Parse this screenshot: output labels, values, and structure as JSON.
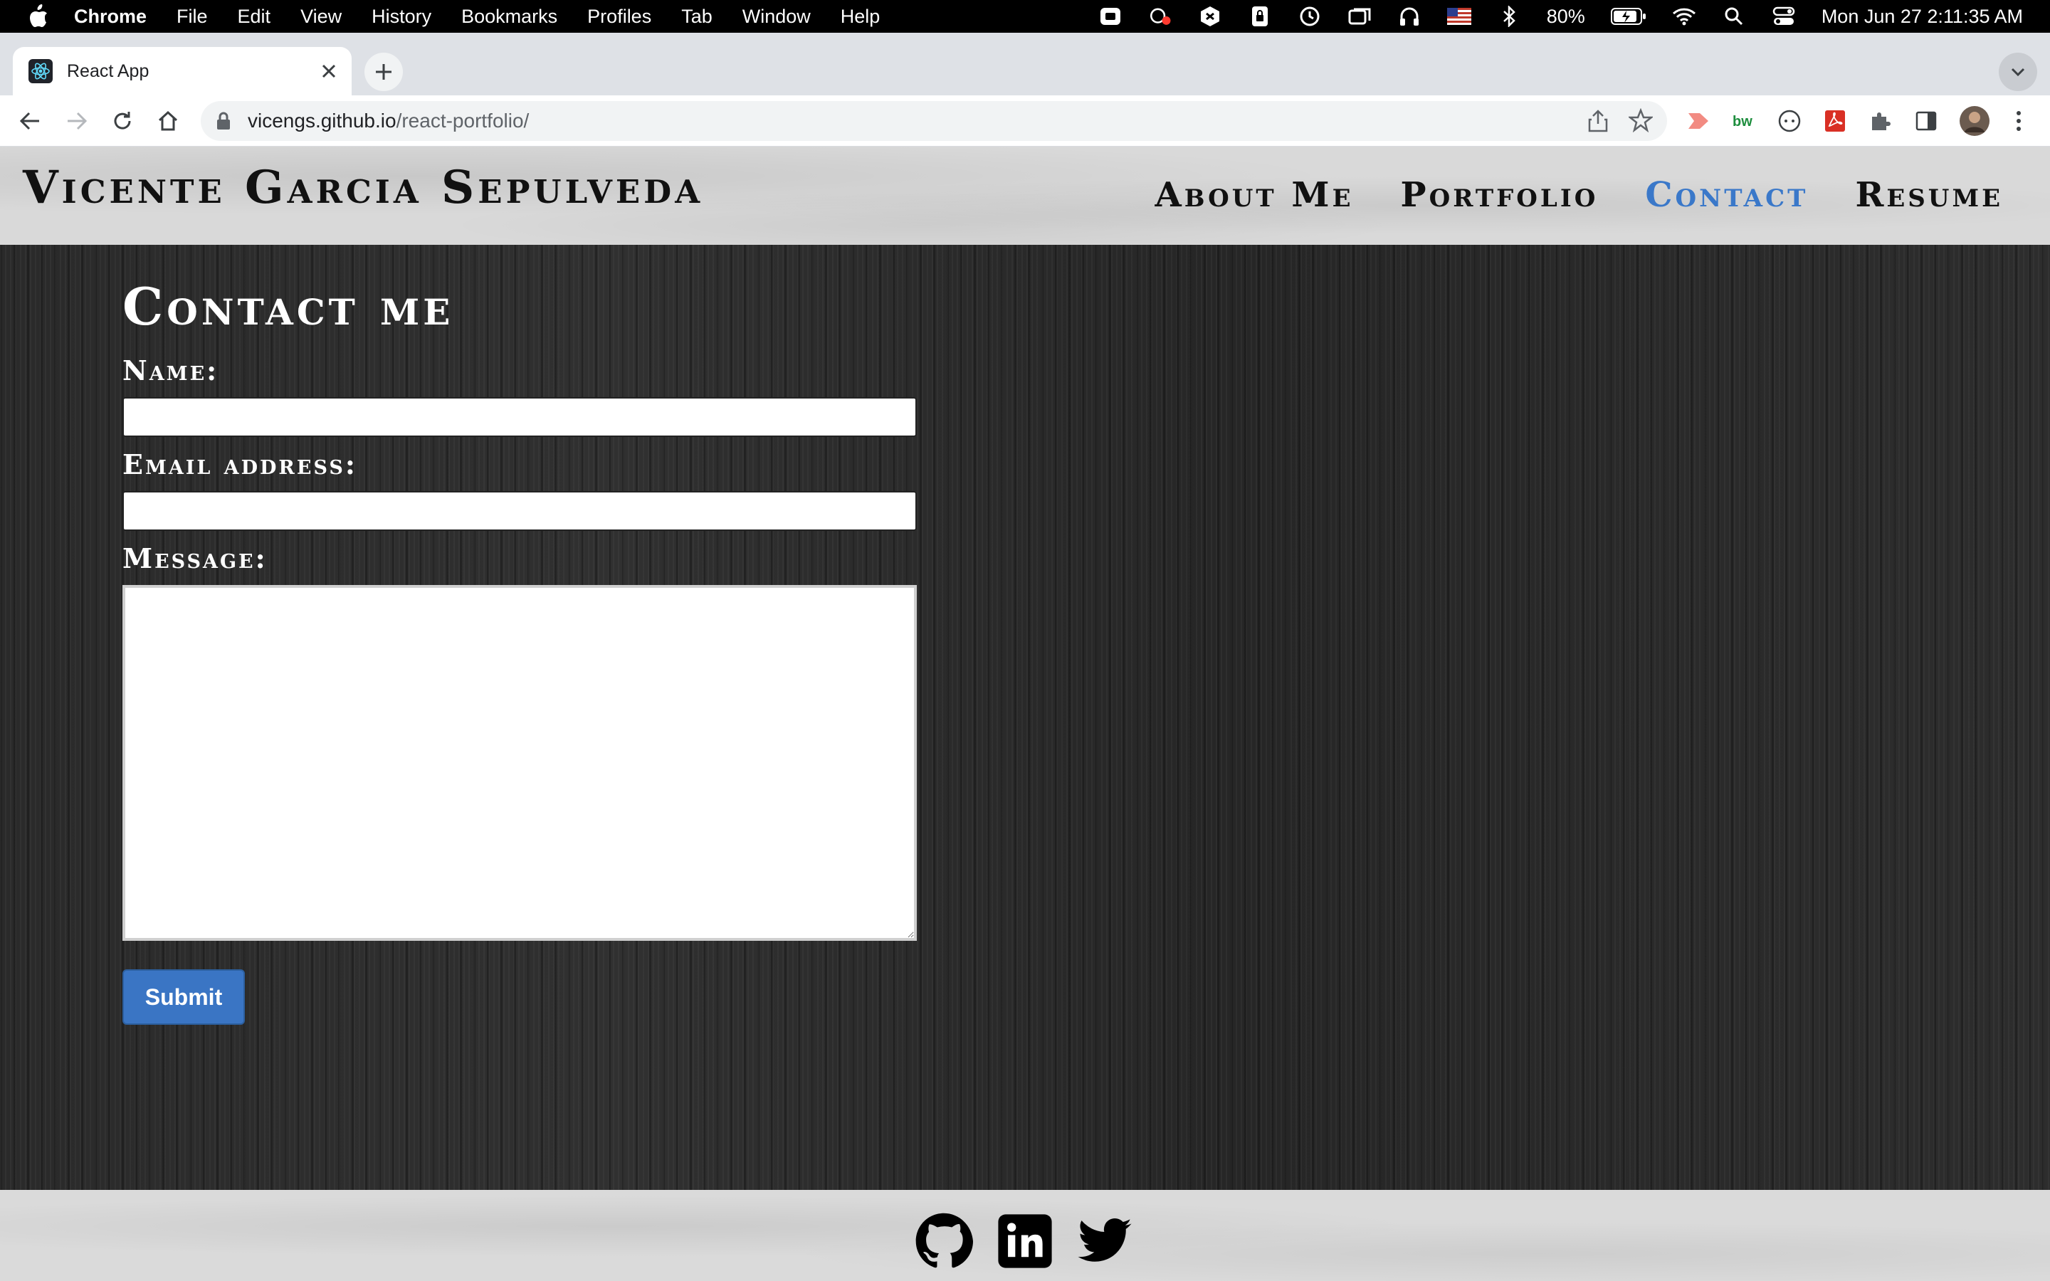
{
  "menubar": {
    "app_name": "Chrome",
    "items": [
      "File",
      "Edit",
      "View",
      "History",
      "Bookmarks",
      "Profiles",
      "Tab",
      "Window",
      "Help"
    ],
    "battery": "80%",
    "datetime": "Mon Jun 27  2:11:35 AM"
  },
  "browser": {
    "tab_title": "React App",
    "url_host": "vicengs.github.io",
    "url_path": "/react-portfolio/"
  },
  "site": {
    "brand": "Vicente Garcia Sepulveda",
    "nav": [
      "About Me",
      "Portfolio",
      "Contact",
      "Resume"
    ],
    "active_nav": "Contact",
    "accent_color": "#3a78c9"
  },
  "form": {
    "title": "Contact me",
    "name_label": "Name:",
    "name_value": "",
    "email_label": "Email address:",
    "email_value": "",
    "message_label": "Message:",
    "message_value": "",
    "submit_label": "Submit"
  },
  "footer": {
    "links": [
      "github-icon",
      "linkedin-icon",
      "twitter-icon"
    ]
  }
}
